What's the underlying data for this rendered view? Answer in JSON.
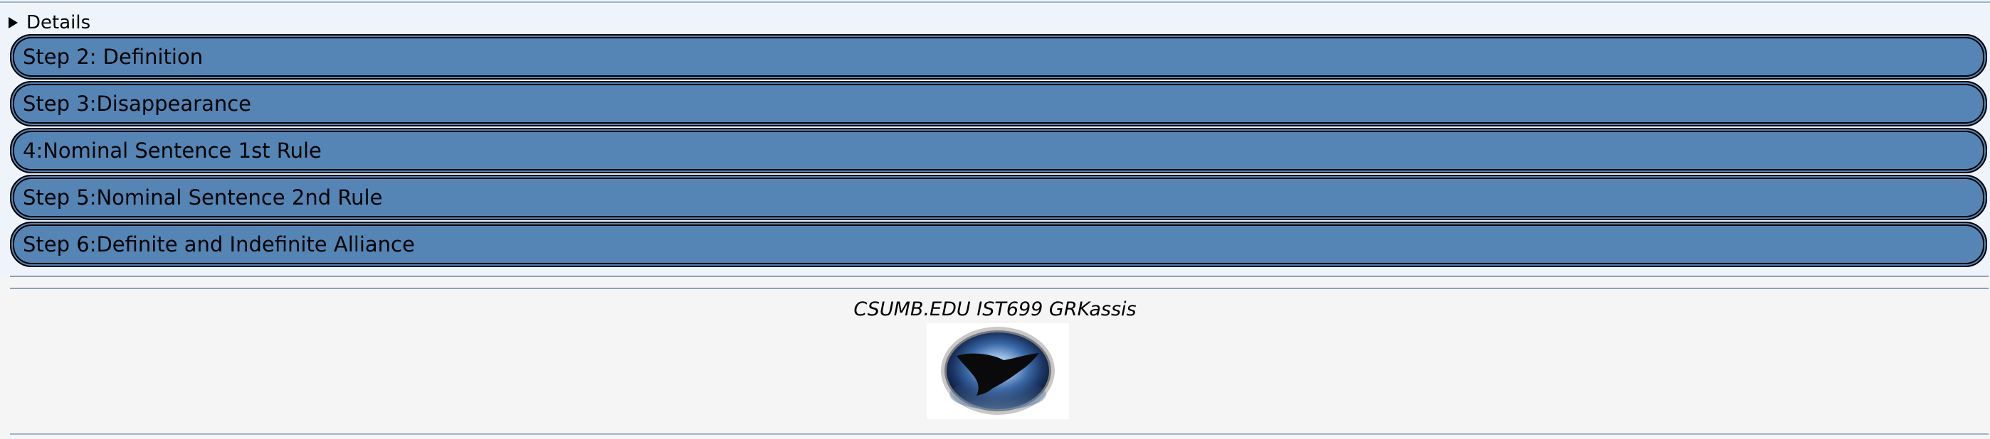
{
  "details": {
    "label": "Details"
  },
  "steps": [
    {
      "label": "Step 2: Definition"
    },
    {
      "label": "Step 3:Disappearance"
    },
    {
      "label": "4:Nominal Sentence 1st Rule"
    },
    {
      "label": "Step 5:Nominal Sentence 2nd Rule"
    },
    {
      "label": "Step 6:Definite and Indefinite Alliance"
    }
  ],
  "footer": {
    "credit": "CSUMB.EDU IST699 GRKassis"
  },
  "colors": {
    "step_fill": "#5585b4",
    "step_border": "#000000",
    "page_background": "#f5f5f5",
    "top_background": "#eef4fa"
  }
}
